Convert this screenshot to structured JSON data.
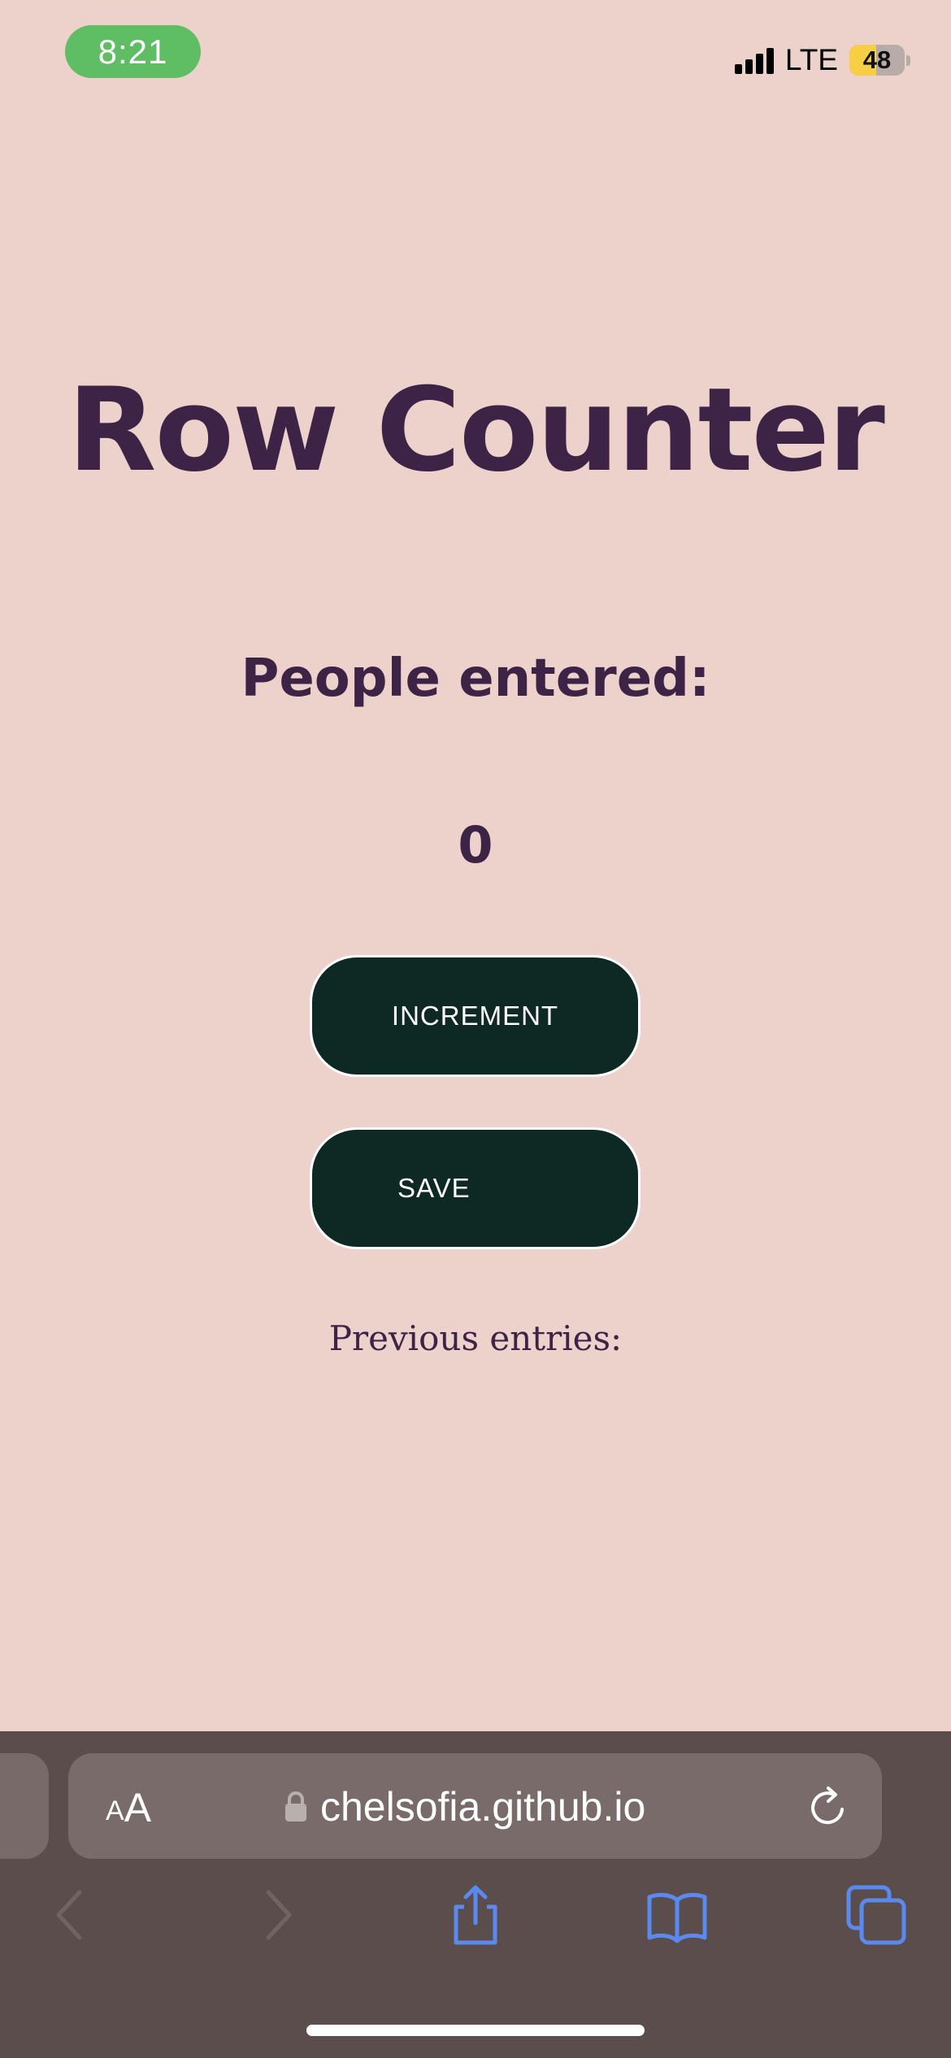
{
  "status_bar": {
    "time": "8:21",
    "network": "LTE",
    "battery": "48",
    "battery_level": 0.48
  },
  "main": {
    "title": "Row Counter",
    "count_label": "People entered:",
    "count_value": "0",
    "increment_label": "INCREMENT",
    "save_label": "SAVE",
    "previous_label": "Previous entries:"
  },
  "browser": {
    "text_size_small": "A",
    "text_size_big": "A",
    "url": "chelsofia.github.io"
  },
  "colors": {
    "background": "#edd2cb",
    "title_text": "#3d2346",
    "button_bg": "#0e2923",
    "browser_bar": "#5b4d4c",
    "toolbar_accent": "#5a8af0"
  }
}
